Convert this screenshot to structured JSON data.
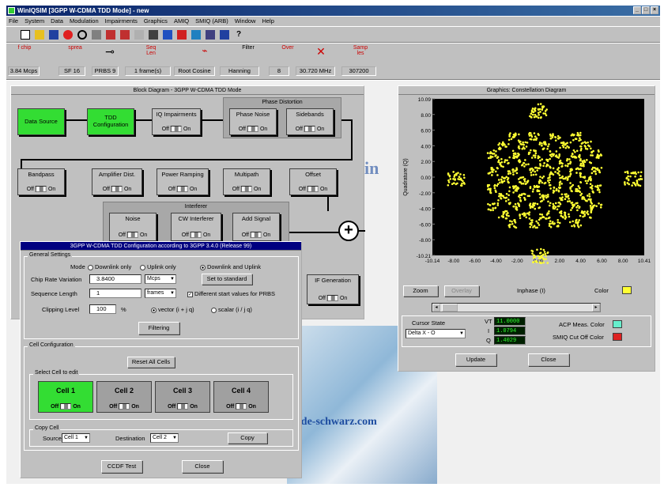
{
  "app": {
    "title": "WinIQSIM [3GPP W-CDMA TDD Mode] - new",
    "win_buttons": [
      "_",
      "□",
      "×"
    ]
  },
  "menu": [
    "File",
    "System",
    "Data",
    "Modulation",
    "Impairments",
    "Graphics",
    "AMIQ",
    "SMIQ (ARB)",
    "Window",
    "Help"
  ],
  "status_values": [
    "3.84 Mcps",
    "SF 16",
    "PRBS 9",
    "1 frame(s)",
    "Root Cosine",
    "Hanning",
    "8",
    "30.720 MHz",
    "307200"
  ],
  "status_icon_labels": [
    "f chip",
    "sprea",
    "",
    "Seq Len",
    "",
    "Filter",
    "",
    "Over",
    "",
    "Samp les"
  ],
  "block_diagram": {
    "title": "Block Diagram - 3GPP W-CDMA TDD Mode",
    "data_source": "Data Source",
    "tdd_config": "TDD Configuration",
    "iq_impairments": "IQ Impairments",
    "phase_distortion": "Phase Distortion",
    "phase_noise": "Phase Noise",
    "sidebands": "Sidebands",
    "bandpass": "Bandpass",
    "amp_dist": "Amplifier Dist.",
    "power_ramping": "Power Ramping",
    "multipath": "Multipath",
    "offset": "Offset",
    "interferer": "Interferer",
    "noise": "Noise",
    "cw_interferer": "CW Interferer",
    "add_signal": "Add Signal",
    "if_generation": "IF Generation",
    "off": "Off",
    "on": "On"
  },
  "graphics": {
    "title": "Graphics: Constellation Diagram",
    "zoom": "Zoom",
    "overlay": "Overlay",
    "xlabel": "Inphase (I)",
    "ylabel": "Quadrature (Q)",
    "color_label": "Color",
    "yticks": [
      "10.09",
      "8.00",
      "6.00",
      "4.00",
      "2.00",
      "0.00",
      "-2.00",
      "-4.00",
      "-6.00",
      "-8.00",
      "-10.21"
    ],
    "xticks": [
      "-10.14",
      "-8.00",
      "-6.00",
      "-4.00",
      "-2.00",
      "0.00",
      "2.00",
      "4.00",
      "6.00",
      "8.00",
      "10.41"
    ],
    "cursor_state_label": "Cursor State",
    "cursor_state_value": "Delta X - O",
    "vt_label": "VT",
    "vt_value": "11.0000",
    "i_label": "I",
    "i_value": "1.0794",
    "q_label": "Q",
    "q_value": "1.4029",
    "acp_label": "ACP Meas. Color",
    "smiq_label": "SMIQ Cut Off Color",
    "update": "Update",
    "close": "Close",
    "colors": {
      "plot_bg": "#000000",
      "points": "#ffff33",
      "acp": "#66eecc",
      "smiq": "#dd2222",
      "color_swatch": "#ffff33"
    }
  },
  "tdd_dialog": {
    "title": "3GPP W-CDMA TDD Configuration according to 3GPP 3.4.0 (Release 99)",
    "general_settings": "General Settings",
    "mode_label": "Mode",
    "mode_options": [
      "Downlink only",
      "Uplink only",
      "Downlink and Uplink"
    ],
    "chip_rate_label": "Chip Rate Variation",
    "chip_rate_value": "3.8400",
    "chip_rate_unit": "Mcps",
    "set_to_standard": "Set to standard",
    "seq_length_label": "Sequence Length",
    "seq_length_value": "1",
    "seq_length_unit": "frames",
    "diff_start": "Different start values for PRBS",
    "clipping_label": "Clipping Level",
    "clipping_value": "100",
    "clipping_unit": "%",
    "vector_opt": "vector (i + j q)",
    "scalar_opt": "scalar (i / j q)",
    "filtering": "Filtering",
    "cell_configuration": "Cell Configuration",
    "reset_all_cells": "Reset All Cells",
    "select_cell": "Select Cell to edit",
    "cells": [
      "Cell 1",
      "Cell 2",
      "Cell 3",
      "Cell 4"
    ],
    "copy_cell": "Copy Cell",
    "source_label": "Source",
    "source_value": "Cell 1",
    "dest_label": "Destination",
    "dest_value": "Cell 2",
    "copy": "Copy",
    "ccdf_test": "CCDF Test",
    "close": "Close"
  },
  "watermark": {
    "mid": "w.rohde-schwarz.com",
    "ghost": "in",
    "bg_text": "hde-schwarz.com"
  }
}
